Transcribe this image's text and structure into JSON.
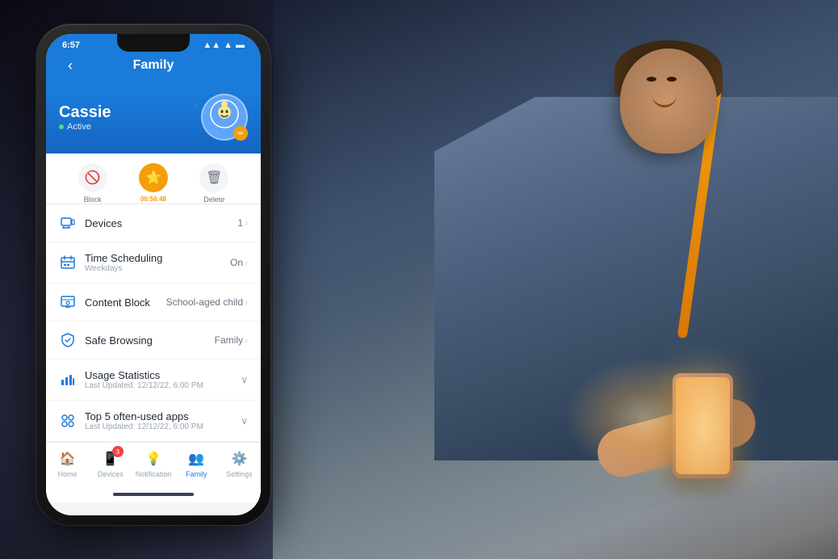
{
  "app": {
    "title": "Family"
  },
  "status_bar": {
    "time": "6:57",
    "signal_icon": "signal-icon",
    "wifi_icon": "wifi-icon",
    "battery_icon": "battery-icon"
  },
  "profile": {
    "name": "Cassie",
    "status": "Active",
    "avatar_icon": "👦",
    "edit_icon": "✏️"
  },
  "actions": {
    "block_label": "Block",
    "timer_label": "00:56:48",
    "delete_label": "Delete"
  },
  "menu_items": [
    {
      "id": "devices",
      "label": "Devices",
      "sublabel": "",
      "value": "1",
      "has_chevron": true,
      "icon": "devices-icon"
    },
    {
      "id": "time_scheduling",
      "label": "Time Scheduling",
      "sublabel": "Weekdays",
      "value": "On",
      "has_chevron": true,
      "icon": "schedule-icon"
    },
    {
      "id": "content_block",
      "label": "Content Block",
      "sublabel": "",
      "value": "School-aged child",
      "has_chevron": true,
      "icon": "content-block-icon"
    },
    {
      "id": "safe_browsing",
      "label": "Safe Browsing",
      "sublabel": "",
      "value": "Family",
      "has_chevron": true,
      "icon": "safe-browsing-icon"
    }
  ],
  "usage_statistics": {
    "label": "Usage Statistics",
    "sublabel": "Last Updated: 12/12/22, 6:00 PM",
    "icon": "stats-icon"
  },
  "top_apps": {
    "label": "Top 5 often-used apps",
    "sublabel": "Last Updated: 12/12/22, 6:00 PM",
    "icon": "apps-icon"
  },
  "bottom_nav": [
    {
      "id": "home",
      "label": "Home",
      "icon": "🏠",
      "active": false
    },
    {
      "id": "devices",
      "label": "Devices",
      "icon": "📱",
      "active": false,
      "badge": "3"
    },
    {
      "id": "notification",
      "label": "Notification",
      "icon": "💡",
      "active": false
    },
    {
      "id": "family",
      "label": "Family",
      "icon": "👥",
      "active": true
    },
    {
      "id": "settings",
      "label": "Settings",
      "icon": "⚙️",
      "active": false
    }
  ]
}
